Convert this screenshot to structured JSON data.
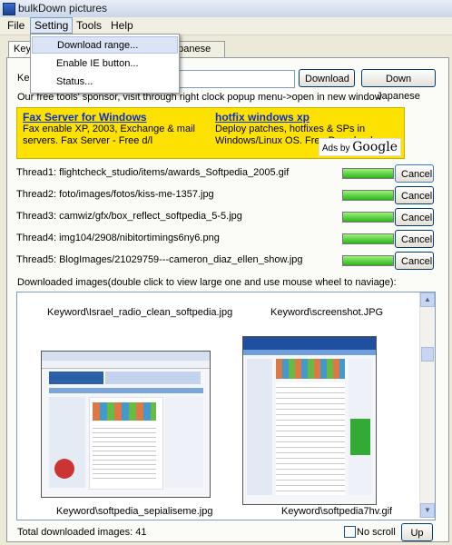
{
  "window": {
    "title": "bulkDown pictures"
  },
  "menubar": {
    "items": [
      "File",
      "Setting",
      "Tools",
      "Help"
    ]
  },
  "setting_menu": {
    "items": [
      "Download range...",
      "Enable IE button...",
      "Status..."
    ]
  },
  "tabs": [
    "Key",
    "apanese"
  ],
  "keyword": {
    "label": "Ke",
    "value": ""
  },
  "buttons": {
    "download": "Download",
    "download_japanese": "Down Japanese"
  },
  "sponsor_text": "Our free tools' sponsor, visit through right clock popup menu->open in new window",
  "ad": {
    "left_title": "Fax Server for Windows",
    "left_body": "Fax enable XP, 2003, Exchange & mail servers. Fax Server - Free d/l",
    "right_title": "hotfix windows xp",
    "right_body": "Deploy patches, hotfixes & SPs in Windows/Linux OS. Free Download.",
    "ads_by": "Ads by",
    "google": "Google"
  },
  "threads": [
    {
      "label": "Thread1:",
      "path": "flightcheck_studio/items/awards_Softpedia_2005.gif",
      "progress": 1.0,
      "cancel": "Cancel"
    },
    {
      "label": "Thread2:",
      "path": "foto/images/fotos/kiss-me-1357.jpg",
      "progress": 1.0,
      "cancel": "Cancel"
    },
    {
      "label": "Thread3:",
      "path": "camwiz/gfx/box_reflect_softpedia_5-5.jpg",
      "progress": 1.0,
      "cancel": "Cancel"
    },
    {
      "label": "Thread4:",
      "path": "img104/2908/nibitortimings6ny6.png",
      "progress": 1.0,
      "cancel": "Cancel"
    },
    {
      "label": "Thread5:",
      "path": "BlogImages/21029759---cameron_diaz_ellen_show.jpg",
      "progress": 1.0,
      "cancel": "Cancel"
    }
  ],
  "downloaded_label": "Downloaded images(double click to view large one and use mouse wheel to naviage):",
  "images": {
    "captions_top": [
      "Keyword\\Israel_radio_clean_softpedia.jpg",
      "Keyword\\screenshot.JPG"
    ],
    "captions_bottom": [
      "Keyword\\softpedia_sepialiseme.jpg",
      "Keyword\\softpedia7hv.gif"
    ]
  },
  "footer": {
    "total_label": "Total downloaded images:",
    "total_value": "41",
    "no_scroll": "No scroll",
    "up": "Up"
  },
  "colors": {
    "ad_background": "#fde100",
    "progress_fill": "#2cb41a",
    "link": "#0b2fcc"
  }
}
